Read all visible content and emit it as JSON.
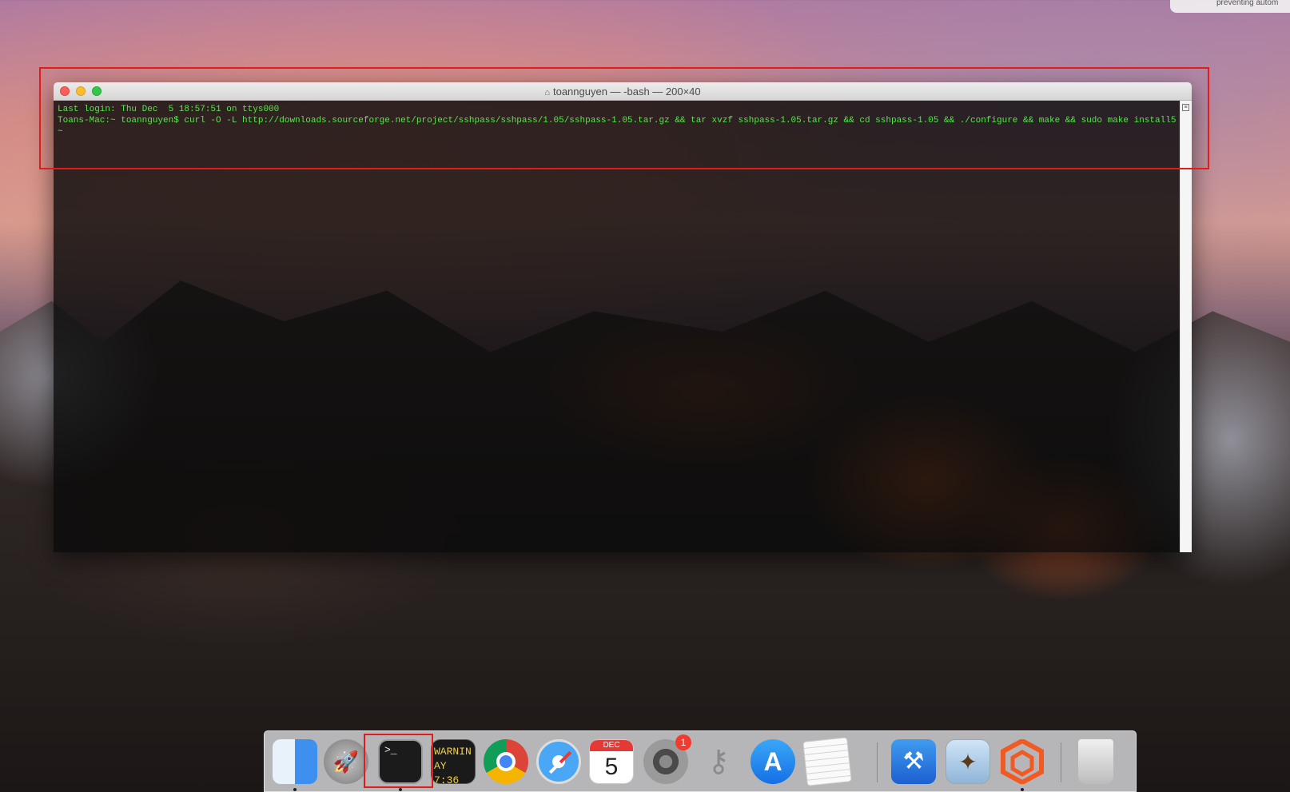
{
  "notification": {
    "text": "preventing autom"
  },
  "terminal_window": {
    "title": "toannguyen — -bash — 200×40",
    "lines": [
      "Last login: Thu Dec  5 18:57:51 on ttys000",
      "Toans-Mac:~ toannguyen$ curl -O -L http://downloads.sourceforge.net/project/sshpass/sshpass/1.05/sshpass-1.05.tar.gz && tar xvzf sshpass-1.05.tar.gz && cd sshpass-1.05 && ./configure && make && sudo make install5~"
    ]
  },
  "dock": {
    "terminal_icon_text": ">_",
    "console_icon_lines": [
      "WARNIN",
      "AY 7:36"
    ],
    "calendar_month": "DEC",
    "calendar_day": "5",
    "prefs_badge": "1",
    "apps": [
      "finder",
      "launchpad",
      "terminal",
      "console",
      "chrome",
      "safari",
      "calendar",
      "system-preferences",
      "keychain-access",
      "app-store",
      "textedit",
      "xcode",
      "preview",
      "hex-app",
      "trash"
    ]
  }
}
